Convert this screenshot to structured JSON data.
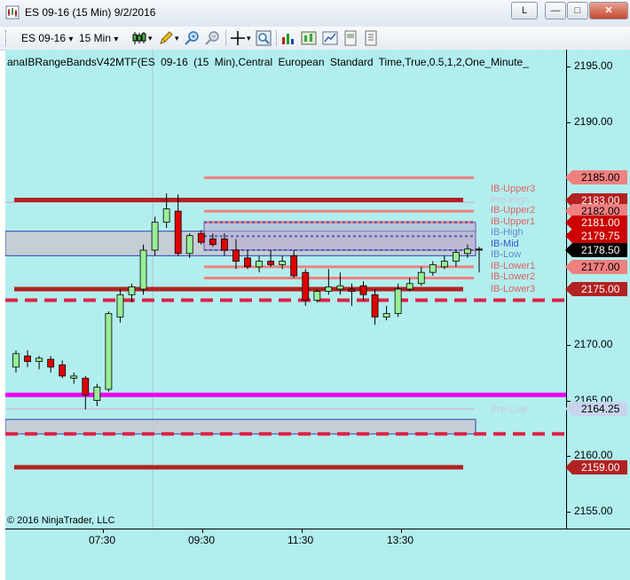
{
  "window": {
    "title": "ES 09-16 (15 Min)  9/2/2016",
    "buttons": {
      "layout": "L",
      "minimize": "—",
      "maximize": "□",
      "close": "✕"
    }
  },
  "toolbar": {
    "instrument": "ES 09-16",
    "interval": "15 Min",
    "dropdown_glyph": "▾"
  },
  "chart": {
    "header": "anaIBRangeBandsV42MTF(ES 09-16 (15 Min),Central European Standard Time,True,0.5,1,2,One_Minute_",
    "f_button": "F",
    "copyright": "© 2016 NinjaTrader, LLC",
    "background": "#b2eeee",
    "price_axis": {
      "ticks": [
        "2195.00",
        "2190.00",
        "2185.00",
        "2180.00",
        "2175.00",
        "2170.00",
        "2165.00",
        "2160.00",
        "2155.00"
      ],
      "range": [
        2153.5,
        2196.5
      ]
    },
    "time_axis": {
      "ticks": [
        "07:30",
        "09:30",
        "11:30",
        "13:30"
      ]
    },
    "price_tags": [
      {
        "label": "2185.00",
        "price": 2185.0,
        "bg": "#f08080",
        "fg": "#000000"
      },
      {
        "label": "2183.00",
        "price": 2183.0,
        "bg": "#b22222",
        "fg": "#ffffff"
      },
      {
        "label": "2182.00",
        "price": 2182.0,
        "bg": "#f08080",
        "fg": "#000000"
      },
      {
        "label": "2181.00",
        "price": 2181.0,
        "bg": "#cc0000",
        "fg": "#ffffff"
      },
      {
        "label": "2179.75",
        "price": 2179.75,
        "bg": "#cc0000",
        "fg": "#ffffff"
      },
      {
        "label": "2178.50",
        "price": 2178.5,
        "bg": "#000000",
        "fg": "#ffffff"
      },
      {
        "label": "2177.00",
        "price": 2177.0,
        "bg": "#f08080",
        "fg": "#000000"
      },
      {
        "label": "2175.00",
        "price": 2175.0,
        "bg": "#b22222",
        "fg": "#ffffff"
      },
      {
        "label": "2164.25",
        "price": 2164.25,
        "bg": "#c8d4ee",
        "fg": "#000000"
      },
      {
        "label": "2159.00",
        "price": 2159.0,
        "bg": "#b22222",
        "fg": "#ffffff"
      }
    ],
    "band_labels": [
      {
        "text": "IB-Upper3",
        "price": 2183.9,
        "color": "#e06060"
      },
      {
        "text": "Pre-High",
        "price": 2182.9,
        "color": "#c8c8d8"
      },
      {
        "text": "IB-Upper2",
        "price": 2182.0,
        "color": "#e06060"
      },
      {
        "text": "IB-Upper1",
        "price": 2181.0,
        "color": "#e06060"
      },
      {
        "text": "IB-High",
        "price": 2180.0,
        "color": "#6688cc"
      },
      {
        "text": "IB-Mid",
        "price": 2179.0,
        "color": "#3355cc"
      },
      {
        "text": "IB-Low",
        "price": 2178.0,
        "color": "#6688cc"
      },
      {
        "text": "IB-Lower1",
        "price": 2177.0,
        "color": "#e06060"
      },
      {
        "text": "IB-Lower2",
        "price": 2176.0,
        "color": "#e06060"
      },
      {
        "text": "IB-Lower3",
        "price": 2174.9,
        "color": "#e06060"
      },
      {
        "text": "Pre-Low",
        "price": 2164.1,
        "color": "#c8c8d8"
      }
    ]
  },
  "chart_data": {
    "type": "candlestick",
    "bar_interval": "15 Min",
    "y_range": [
      2153.5,
      2196.5
    ],
    "x_ticks": [
      "07:30",
      "09:30",
      "11:30",
      "13:30"
    ],
    "candles": [
      {
        "o": 2168.0,
        "h": 2169.5,
        "l": 2167.5,
        "c": 2169.2
      },
      {
        "o": 2169.0,
        "h": 2169.5,
        "l": 2168.0,
        "c": 2168.5
      },
      {
        "o": 2168.5,
        "h": 2169.0,
        "l": 2167.8,
        "c": 2168.8
      },
      {
        "o": 2168.7,
        "h": 2169.0,
        "l": 2167.5,
        "c": 2168.0
      },
      {
        "o": 2168.2,
        "h": 2168.6,
        "l": 2167.0,
        "c": 2167.2
      },
      {
        "o": 2167.0,
        "h": 2167.5,
        "l": 2166.5,
        "c": 2167.2
      },
      {
        "o": 2167.0,
        "h": 2167.2,
        "l": 2164.2,
        "c": 2165.5
      },
      {
        "o": 2165.0,
        "h": 2166.5,
        "l": 2164.5,
        "c": 2166.2
      },
      {
        "o": 2166.0,
        "h": 2173.0,
        "l": 2165.8,
        "c": 2172.8
      },
      {
        "o": 2172.5,
        "h": 2175.0,
        "l": 2172.0,
        "c": 2174.5
      },
      {
        "o": 2174.5,
        "h": 2175.5,
        "l": 2173.8,
        "c": 2175.2
      },
      {
        "o": 2175.0,
        "h": 2179.0,
        "l": 2174.5,
        "c": 2178.5
      },
      {
        "o": 2178.5,
        "h": 2181.5,
        "l": 2178.0,
        "c": 2181.0
      },
      {
        "o": 2181.0,
        "h": 2183.6,
        "l": 2180.5,
        "c": 2182.2
      },
      {
        "o": 2182.0,
        "h": 2183.5,
        "l": 2178.0,
        "c": 2178.2
      },
      {
        "o": 2178.2,
        "h": 2180.0,
        "l": 2177.8,
        "c": 2179.8
      },
      {
        "o": 2180.0,
        "h": 2180.3,
        "l": 2179.0,
        "c": 2179.2
      },
      {
        "o": 2179.5,
        "h": 2180.0,
        "l": 2178.8,
        "c": 2179.0
      },
      {
        "o": 2179.5,
        "h": 2180.0,
        "l": 2178.0,
        "c": 2178.5
      },
      {
        "o": 2178.5,
        "h": 2179.5,
        "l": 2176.8,
        "c": 2177.5
      },
      {
        "o": 2177.8,
        "h": 2178.5,
        "l": 2176.8,
        "c": 2177.0
      },
      {
        "o": 2177.0,
        "h": 2178.0,
        "l": 2176.5,
        "c": 2177.5
      },
      {
        "o": 2177.5,
        "h": 2178.5,
        "l": 2177.0,
        "c": 2177.2
      },
      {
        "o": 2177.2,
        "h": 2178.0,
        "l": 2176.8,
        "c": 2177.5
      },
      {
        "o": 2178.0,
        "h": 2178.5,
        "l": 2176.0,
        "c": 2176.2
      },
      {
        "o": 2176.5,
        "h": 2176.8,
        "l": 2173.5,
        "c": 2174.0
      },
      {
        "o": 2174.0,
        "h": 2175.0,
        "l": 2173.8,
        "c": 2174.8
      },
      {
        "o": 2174.8,
        "h": 2176.8,
        "l": 2174.5,
        "c": 2175.2
      },
      {
        "o": 2175.0,
        "h": 2176.5,
        "l": 2174.5,
        "c": 2175.3
      },
      {
        "o": 2175.0,
        "h": 2175.5,
        "l": 2173.5,
        "c": 2174.8
      },
      {
        "o": 2175.3,
        "h": 2175.7,
        "l": 2174.0,
        "c": 2174.5
      },
      {
        "o": 2174.5,
        "h": 2175.0,
        "l": 2171.8,
        "c": 2172.5
      },
      {
        "o": 2172.5,
        "h": 2173.5,
        "l": 2172.2,
        "c": 2172.8
      },
      {
        "o": 2172.8,
        "h": 2175.5,
        "l": 2172.5,
        "c": 2175.0
      },
      {
        "o": 2175.0,
        "h": 2176.0,
        "l": 2174.8,
        "c": 2175.5
      },
      {
        "o": 2175.5,
        "h": 2177.0,
        "l": 2175.3,
        "c": 2176.5
      },
      {
        "o": 2176.5,
        "h": 2177.5,
        "l": 2176.2,
        "c": 2177.2
      },
      {
        "o": 2177.0,
        "h": 2178.0,
        "l": 2176.8,
        "c": 2177.5
      },
      {
        "o": 2177.5,
        "h": 2178.5,
        "l": 2177.0,
        "c": 2178.3
      },
      {
        "o": 2178.2,
        "h": 2179.0,
        "l": 2177.8,
        "c": 2178.6
      },
      {
        "o": 2178.6,
        "h": 2178.8,
        "l": 2176.5,
        "c": 2178.5
      }
    ],
    "levels": [
      {
        "name": "IB-Upper3",
        "price": 2185.0,
        "color": "#f08080"
      },
      {
        "name": "IB-Upper2",
        "price": 2182.0,
        "color": "#f08080"
      },
      {
        "name": "IB-Upper1",
        "price": 2181.0,
        "color": "#f08080"
      },
      {
        "name": "IB-High",
        "price": 2181.0,
        "color": "#4060c0"
      },
      {
        "name": "IB-Mid",
        "price": 2179.75,
        "color": "#4060c0"
      },
      {
        "name": "IB-Low",
        "price": 2178.5,
        "color": "#4060c0"
      },
      {
        "name": "IB-Lower1",
        "price": 2177.0,
        "color": "#f08080"
      },
      {
        "name": "IB-Lower2",
        "price": 2176.0,
        "color": "#f08080"
      },
      {
        "name": "IB-Lower3",
        "price": 2175.0,
        "color": "#b22222"
      },
      {
        "name": "Pre-High",
        "price": 2182.8,
        "color": "#c8c8d8"
      },
      {
        "name": "Pre-Low",
        "price": 2164.25,
        "color": "#c8c8d8"
      },
      {
        "price": 2183.0,
        "color": "#b22222"
      },
      {
        "price": 2159.0,
        "color": "#b22222"
      },
      {
        "price": 2174.0,
        "color": "#dd2244"
      },
      {
        "price": 2162.0,
        "color": "#dd2244"
      },
      {
        "price": 2165.5,
        "color": "#ee00ee"
      }
    ],
    "zones": [
      {
        "from": 2178.0,
        "to": 2180.2,
        "fill": "#c8c8d0",
        "border": "#3040b0"
      },
      {
        "from": 2162.0,
        "to": 2163.3,
        "fill": "#c8c8d0",
        "border": "#3040b0"
      }
    ]
  }
}
